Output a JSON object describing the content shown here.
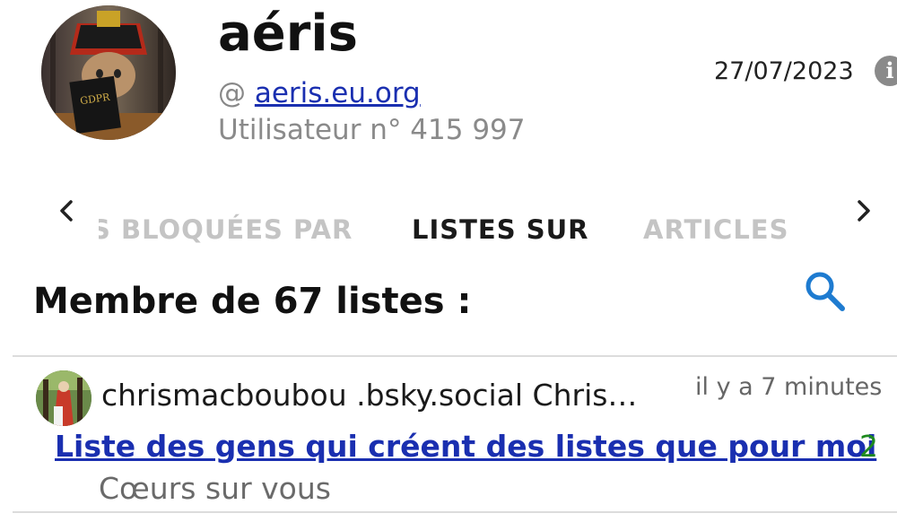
{
  "profile": {
    "display_name": "aéris",
    "handle_prefix": "@",
    "handle": "aeris.eu.org",
    "user_number": "Utilisateur n° 415 997",
    "date": "27/07/2023",
    "avatar_book_text": "GDPR"
  },
  "tabs": [
    {
      "label": "S BLOQUÉES PAR",
      "state": "partial"
    },
    {
      "label": "LISTES SUR",
      "state": "active"
    },
    {
      "label": "ARTICLES",
      "state": "inactive"
    }
  ],
  "section": {
    "heading": "Membre de 67 listes :"
  },
  "lists": [
    {
      "creator": "chrismacboubou .bsky.social Chris…",
      "time": "il y a 7 minutes",
      "title": "Liste des gens qui créent des listes que pour moi",
      "count": "2",
      "description": "Cœurs sur vous"
    }
  ],
  "icons": {
    "info": "info-icon",
    "prev": "chevron-left-icon",
    "next": "chevron-right-icon",
    "search": "search-icon"
  },
  "colors": {
    "link": "#1a2fb0",
    "accent": "#1e7bd0",
    "count": "#1e8a1e",
    "muted": "#8a8a8a"
  }
}
